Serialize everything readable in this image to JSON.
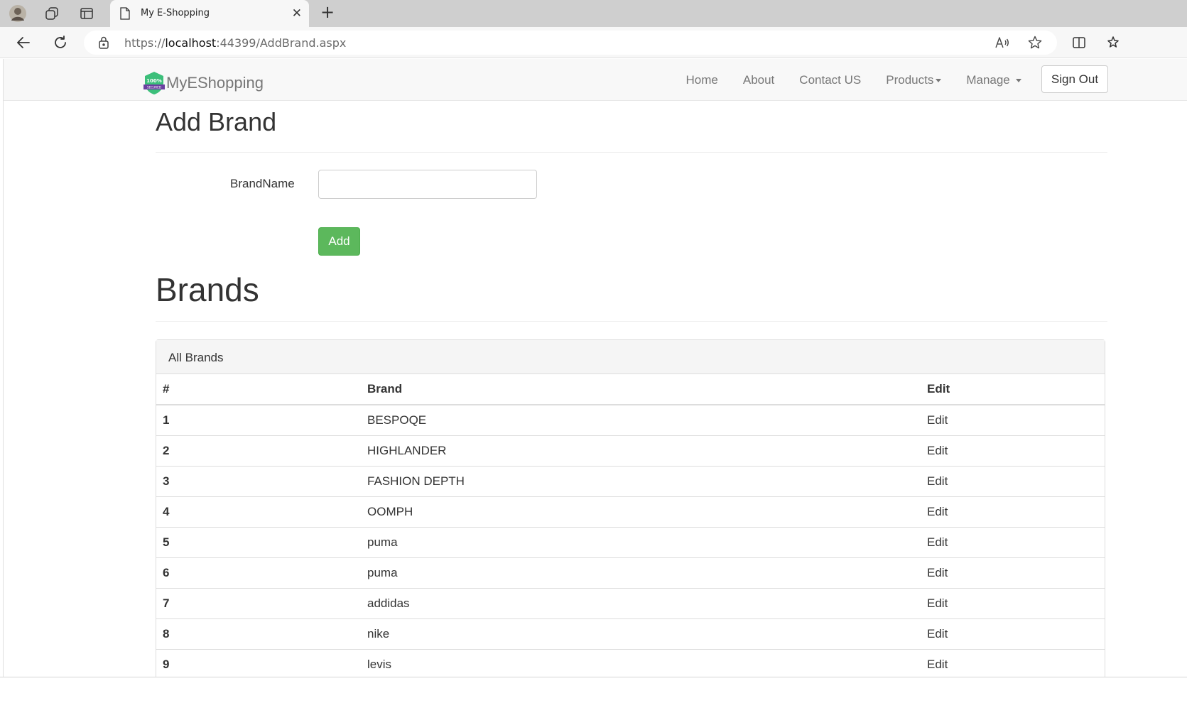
{
  "browser": {
    "tab_title": "My E-Shopping",
    "tab_close": "✕",
    "new_tab": "+",
    "url_scheme": "https://",
    "url_host": "localhost",
    "url_rest": ":44399/AddBrand.aspx"
  },
  "navbar": {
    "brand_name": "MyEShopping",
    "badge_text_top": "100%",
    "badge_text_bottom": "SECURED",
    "links": {
      "home": "Home",
      "about": "About",
      "contact": "Contact US",
      "products": "Products",
      "manage": "Manage"
    },
    "signout": "Sign Out"
  },
  "form": {
    "heading": "Add Brand",
    "brandname_label": "BrandName",
    "brandname_value": "",
    "add_button": "Add"
  },
  "brands": {
    "heading": "Brands",
    "panel_title": "All Brands",
    "columns": [
      "#",
      "Brand",
      "Edit"
    ],
    "rows": [
      {
        "num": "1",
        "brand": "BESPOQE",
        "edit": "Edit"
      },
      {
        "num": "2",
        "brand": "HIGHLANDER",
        "edit": "Edit"
      },
      {
        "num": "3",
        "brand": "FASHION DEPTH",
        "edit": "Edit"
      },
      {
        "num": "4",
        "brand": "OOMPH",
        "edit": "Edit"
      },
      {
        "num": "5",
        "brand": "puma",
        "edit": "Edit"
      },
      {
        "num": "6",
        "brand": "puma",
        "edit": "Edit"
      },
      {
        "num": "7",
        "brand": "addidas",
        "edit": "Edit"
      },
      {
        "num": "8",
        "brand": "nike",
        "edit": "Edit"
      },
      {
        "num": "9",
        "brand": "levis",
        "edit": "Edit"
      }
    ]
  },
  "colors": {
    "success": "#5cb85c",
    "navbar_bg": "#f8f8f8",
    "badge_green": "#3cbf7a",
    "badge_purple": "#6b3fa0"
  }
}
